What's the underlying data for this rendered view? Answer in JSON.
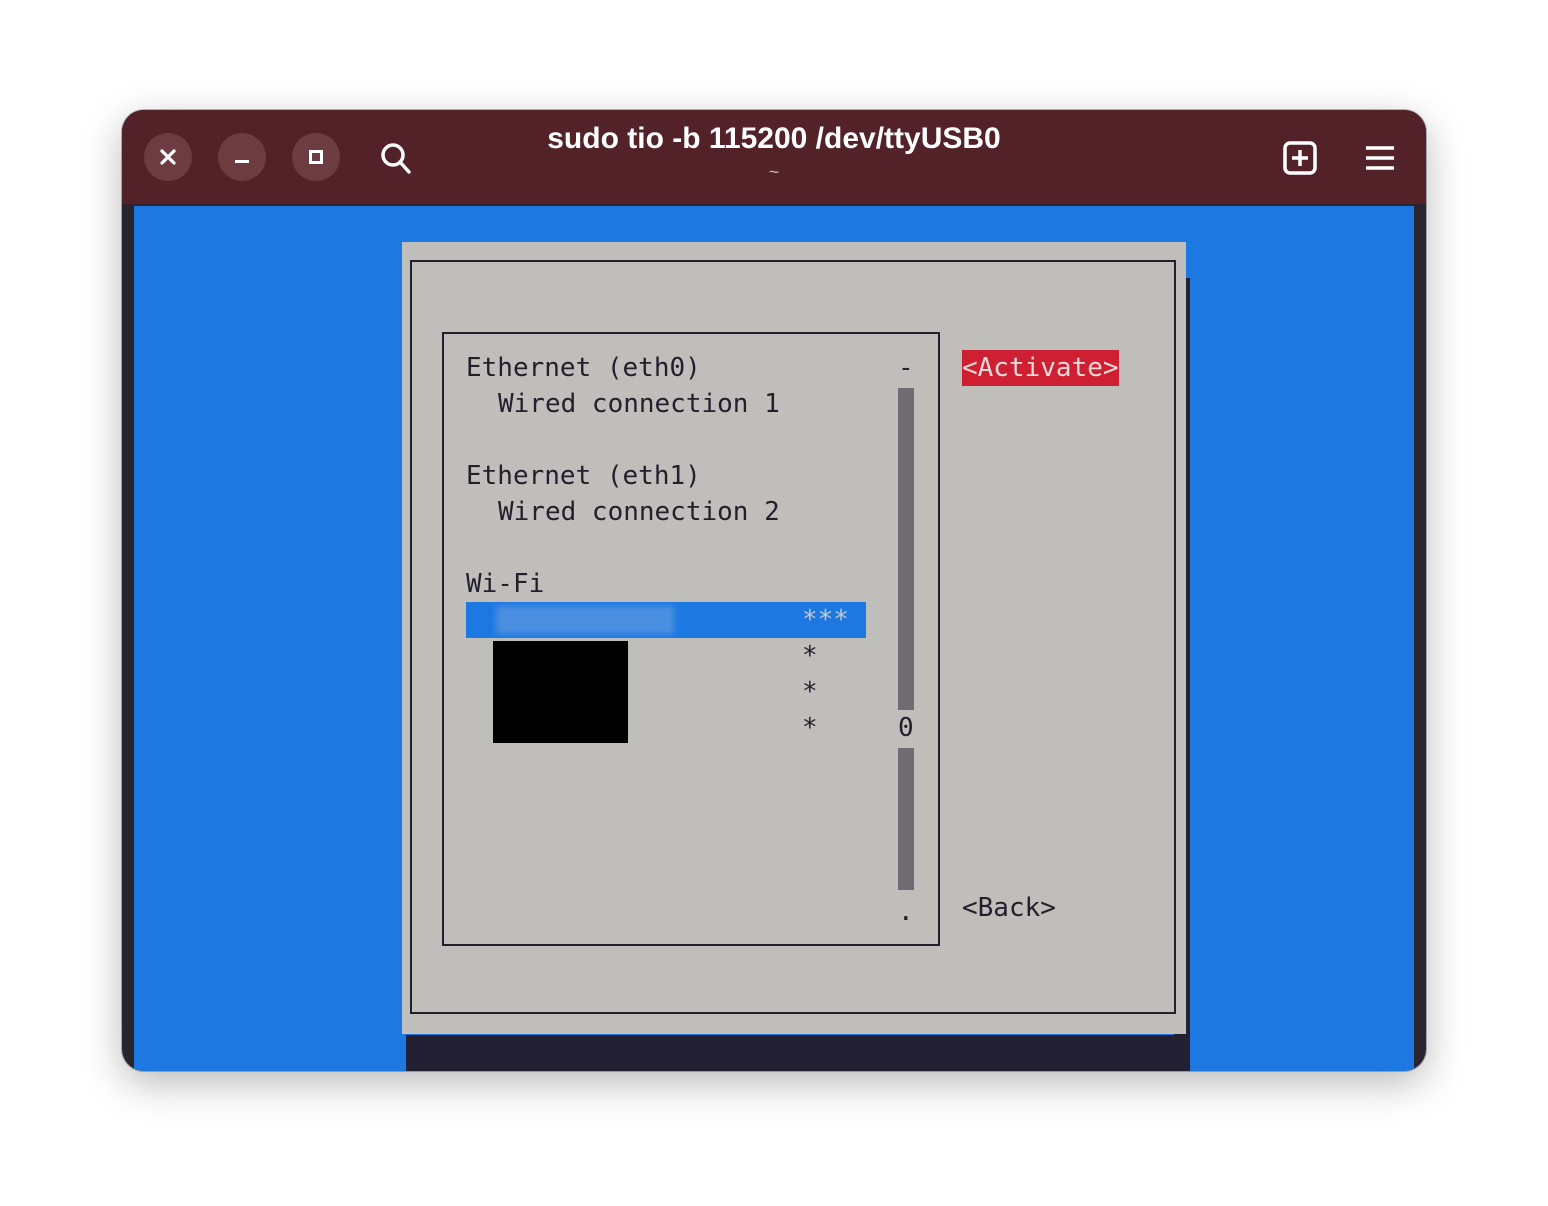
{
  "window": {
    "title": "sudo tio -b 115200 /dev/ttyUSB0",
    "subtitle": "~"
  },
  "list": {
    "devices": [
      {
        "name": "Ethernet (eth0)",
        "connection": "Wired connection 1"
      },
      {
        "name": "Ethernet (eth1)",
        "connection": "Wired connection 2"
      }
    ],
    "wifi_header": "Wi-Fi",
    "wifi_signals": [
      "***",
      "*",
      "*",
      "*"
    ],
    "scroll_top": "-",
    "scroll_thumb": "0",
    "scroll_bottom": "."
  },
  "buttons": {
    "activate": "<Activate>",
    "back": "<Back>"
  },
  "colors": {
    "titlebar": "#522228",
    "terminal_bg": "#1e78e2",
    "dialog_bg": "#c0bebb",
    "activate_bg": "#cf2033"
  }
}
